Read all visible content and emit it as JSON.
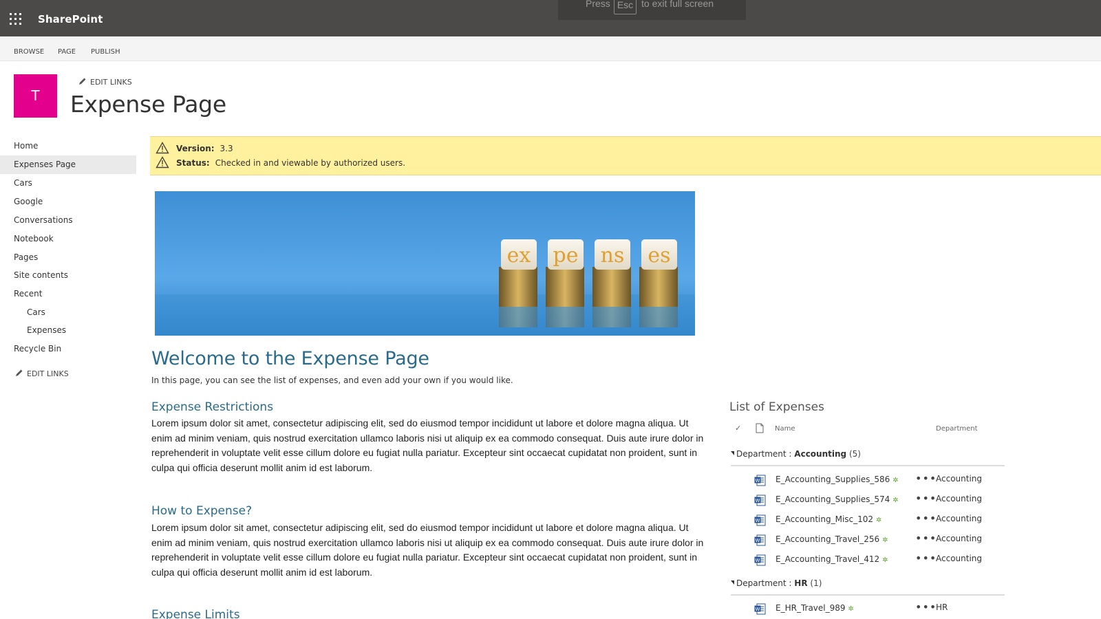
{
  "suite": {
    "brand": "SharePoint"
  },
  "fullscreen_notice": {
    "before": "Press",
    "key": "Esc",
    "after": "to exit full screen"
  },
  "ribbon": {
    "tabs": [
      "BROWSE",
      "PAGE",
      "PUBLISH"
    ]
  },
  "site": {
    "logo_letter": "T",
    "edit_links": "EDIT LINKS",
    "page_title": "Expense Page"
  },
  "leftnav": {
    "items": [
      {
        "label": "Home"
      },
      {
        "label": "Expenses Page"
      },
      {
        "label": "Cars"
      },
      {
        "label": "Google"
      },
      {
        "label": "Conversations"
      },
      {
        "label": "Notebook"
      },
      {
        "label": "Pages"
      },
      {
        "label": "Site contents"
      },
      {
        "label": "Recent"
      },
      {
        "label": "Cars"
      },
      {
        "label": "Expenses"
      },
      {
        "label": "Recycle Bin"
      }
    ],
    "edit_links": "EDIT LINKS"
  },
  "status": {
    "version_label": "Version:",
    "version_value": "3.3",
    "status_label": "Status:",
    "status_value": "Checked in and viewable by authorized users."
  },
  "hero": {
    "blocks": [
      "ex",
      "pe",
      "ns",
      "es"
    ]
  },
  "content": {
    "welcome_title": "Welcome to the Expense Page",
    "intro": "In this page, you can see the list of expenses, and even add your own if you would like.",
    "sections": [
      {
        "heading": "Expense Restrictions",
        "body": "Lorem ipsum dolor sit amet, consectetur adipiscing elit, sed do eiusmod tempor incididunt ut labore et dolore magna aliqua. Ut enim ad minim veniam, quis nostrud exercitation ullamco laboris nisi ut aliquip ex ea commodo consequat. Duis aute irure dolor in reprehenderit in voluptate velit esse cillum dolore eu fugiat nulla pariatur. Excepteur sint occaecat cupidatat non proident, sunt in culpa qui officia deserunt mollit anim id est laborum."
      },
      {
        "heading": "How to Expense?",
        "body": "Lorem ipsum dolor sit amet, consectetur adipiscing elit, sed do eiusmod tempor incididunt ut labore et dolore magna aliqua. Ut enim ad minim veniam, quis nostrud exercitation ullamco laboris nisi ut aliquip ex ea commodo consequat. Duis aute irure dolor in reprehenderit in voluptate velit esse cillum dolore eu fugiat nulla pariatur. Excepteur sint occaecat cupidatat non proident, sunt in culpa qui officia deserunt mollit anim id est laborum."
      },
      {
        "heading": "Expense Limits",
        "body": ""
      }
    ]
  },
  "expenses_list": {
    "title": "List of Expenses",
    "columns": {
      "name": "Name",
      "department": "Department"
    },
    "groups": [
      {
        "prefix": "Department : ",
        "name": "Accounting",
        "count": "(5)",
        "rows": [
          {
            "name": "E_Accounting_Supplies_586",
            "department": "Accounting"
          },
          {
            "name": "E_Accounting_Supplies_574",
            "department": "Accounting"
          },
          {
            "name": "E_Accounting_Misc_102",
            "department": "Accounting"
          },
          {
            "name": "E_Accounting_Travel_256",
            "department": "Accounting"
          },
          {
            "name": "E_Accounting_Travel_412",
            "department": "Accounting"
          }
        ]
      },
      {
        "prefix": "Department : ",
        "name": "HR",
        "count": "(1)",
        "rows": [
          {
            "name": "E_HR_Travel_989",
            "department": "HR"
          }
        ]
      }
    ]
  },
  "colors": {
    "suitebar": "#4c4a48",
    "site_logo": "#e3008c",
    "status_bar": "#fff19d",
    "heading_accent": "#2a6b8a",
    "new_item_mark": "#5ea332"
  }
}
